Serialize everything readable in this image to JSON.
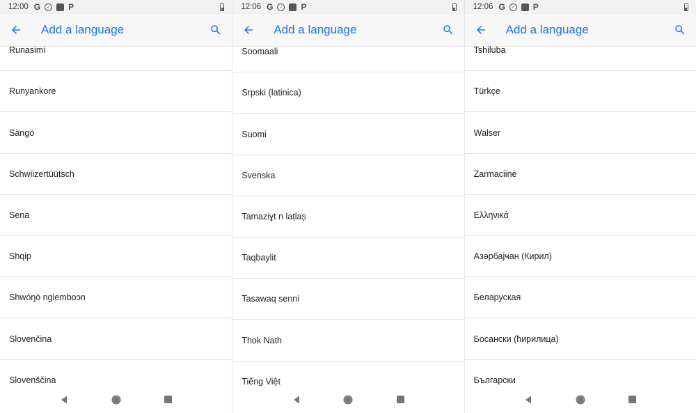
{
  "screens": [
    {
      "status": {
        "time": "12:00",
        "icons": [
          "google-icon",
          "circle-icon",
          "square-icon",
          "p-icon"
        ],
        "battery": "battery-icon"
      },
      "app_bar": {
        "title": "Add a language",
        "back_icon": "back-arrow-icon",
        "search_icon": "search-icon"
      },
      "languages": [
        "Runasimi",
        "Runyankore",
        "Sängö",
        "Schwiizertüütsch",
        "Sena",
        "Shqip",
        "Shwóŋò ngiemboɔn",
        "Slovenčina",
        "Slovenščina"
      ],
      "nav": [
        "back-triangle-icon",
        "home-circle-icon",
        "recents-square-icon"
      ]
    },
    {
      "status": {
        "time": "12:06",
        "icons": [
          "google-icon",
          "circle-icon",
          "square-icon",
          "p-icon"
        ],
        "battery": "battery-icon"
      },
      "app_bar": {
        "title": "Add a language",
        "back_icon": "back-arrow-icon",
        "search_icon": "search-icon"
      },
      "languages": [
        "Soomaali",
        "Srpski (latinica)",
        "Suomi",
        "Svenska",
        "Tamaziɣt n laṭlaṣ",
        "Taqbaylit",
        "Tasawaq senni",
        "Thok Nath",
        "Tiếng Việt"
      ],
      "nav": [
        "back-triangle-icon",
        "home-circle-icon",
        "recents-square-icon"
      ]
    },
    {
      "status": {
        "time": "12:06",
        "icons": [
          "google-icon",
          "circle-icon",
          "square-icon",
          "p-icon"
        ],
        "battery": "battery-icon"
      },
      "app_bar": {
        "title": "Add a language",
        "back_icon": "back-arrow-icon",
        "search_icon": "search-icon"
      },
      "languages": [
        "Tshiluba",
        "Türkçe",
        "Walser",
        "Zarmaciine",
        "Ελληνικά",
        "Азәрбајҹан (Кирил)",
        "Беларуская",
        "Босански (ћирилица)",
        "Български"
      ],
      "nav": [
        "back-triangle-icon",
        "home-circle-icon",
        "recents-square-icon"
      ]
    }
  ],
  "colors": {
    "accent": "#1a73e8",
    "text": "#212121",
    "divider": "#e0e0e0",
    "status_bar": "#f2f2f2",
    "app_bar": "#f7f7f7"
  }
}
